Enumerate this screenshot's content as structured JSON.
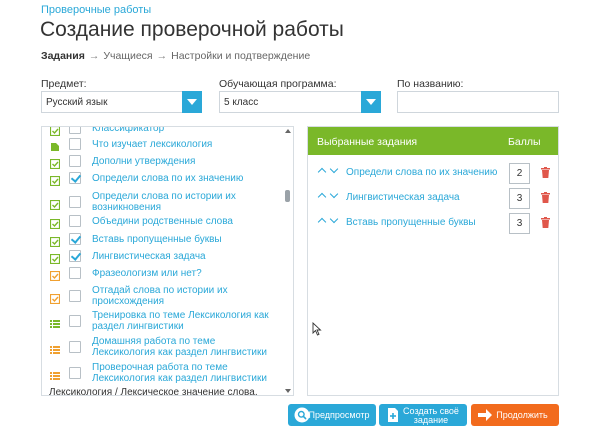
{
  "breadcrumb": "Проверочные работы",
  "title": "Создание проверочной работы",
  "steps": [
    "Задания",
    "Учащиеся",
    "Настройки и подтверждение"
  ],
  "filters": {
    "subject_label": "Предмет:",
    "subject_value": "Русский язык",
    "program_label": "Обучающая программа:",
    "program_value": "5 класс",
    "name_label": "По названию:",
    "name_value": ""
  },
  "tasks": [
    {
      "label": "Классификатор",
      "checked": false,
      "icon": "check-icon-green"
    },
    {
      "label": "Что изучает лексикология",
      "checked": false,
      "icon": "tag-icon-green"
    },
    {
      "label": "Дополни утверждения",
      "checked": false,
      "icon": "check-icon-green"
    },
    {
      "label": "Определи слова по их значению",
      "checked": true,
      "icon": "check-icon-green"
    },
    {
      "label": "Определи слова по истории их возникновения",
      "checked": false,
      "icon": "check-icon-green"
    },
    {
      "label": "Объедини родственные слова",
      "checked": false,
      "icon": "check-icon-green"
    },
    {
      "label": "Вставь пропущенные буквы",
      "checked": true,
      "icon": "check-icon-green"
    },
    {
      "label": "Лингвистическая задача",
      "checked": true,
      "icon": "check-icon-green"
    },
    {
      "label": "Фразеологизм или нет?",
      "checked": false,
      "icon": "check-icon-orange"
    },
    {
      "label": "Отгадай слова по истории их происхождения",
      "checked": false,
      "icon": "check-icon-orange"
    },
    {
      "label": "Тренировка по теме Лексикология как раздел лингвистики",
      "checked": false,
      "icon": "list-icon-green"
    },
    {
      "label": "Домашняя работа по теме Лексикология как раздел лингвистики",
      "checked": false,
      "icon": "list-icon-orange"
    },
    {
      "label": "Проверочная работа по теме Лексикология как раздел лингвистики",
      "checked": false,
      "icon": "list-icon-orange"
    }
  ],
  "list_footer": "Лексикология / Лексическое значение слова.",
  "selected_panel": {
    "header_name": "Выбранные задания",
    "header_score": "Баллы",
    "items": [
      {
        "label": "Определи слова по их значению",
        "score": "2"
      },
      {
        "label": "Лингвистическая задача",
        "score": "3"
      },
      {
        "label": "Вставь пропущенные буквы",
        "score": "3"
      }
    ]
  },
  "buttons": {
    "preview": "Предпросмотр",
    "create": "Создать своё задание",
    "continue": "Продолжить"
  },
  "colors": {
    "accent": "#2aa8d8",
    "header_green": "#7ab829",
    "continue_orange": "#f26b1d",
    "trash_red": "#e0574b"
  }
}
